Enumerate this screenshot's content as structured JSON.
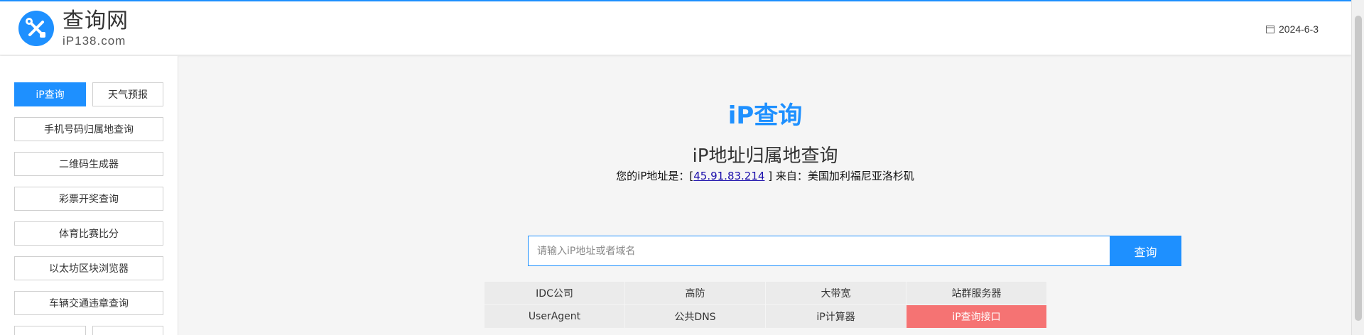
{
  "header": {
    "site_title": "查询网",
    "site_domain": "iP138.com",
    "date": "2024-6-3"
  },
  "sidebar": {
    "items": [
      {
        "label": "iP查询",
        "active": true
      },
      {
        "label": "天气预报"
      },
      {
        "label": "手机号码归属地查询"
      },
      {
        "label": "二维码生成器"
      },
      {
        "label": "彩票开奖查询"
      },
      {
        "label": "体育比赛比分"
      },
      {
        "label": "以太坊区块浏览器"
      },
      {
        "label": "车辆交通违章查询"
      }
    ]
  },
  "main": {
    "title": "iP查询",
    "subtitle": "iP地址归属地查询",
    "ip_prefix": "您的iP地址是：[",
    "ip_address": "45.91.83.214",
    "ip_suffix": " ] 来自：美国加利福尼亚洛杉矶",
    "search": {
      "placeholder": "请输入iP地址或者域名",
      "button_label": "查询"
    },
    "links": [
      "IDC公司",
      "高防",
      "大带宽",
      "站群服务器",
      "UserAgent",
      "公共DNS",
      "iP计算器",
      "iP查询接口"
    ]
  },
  "colors": {
    "accent": "#1e90ff",
    "highlight": "#f57373"
  }
}
